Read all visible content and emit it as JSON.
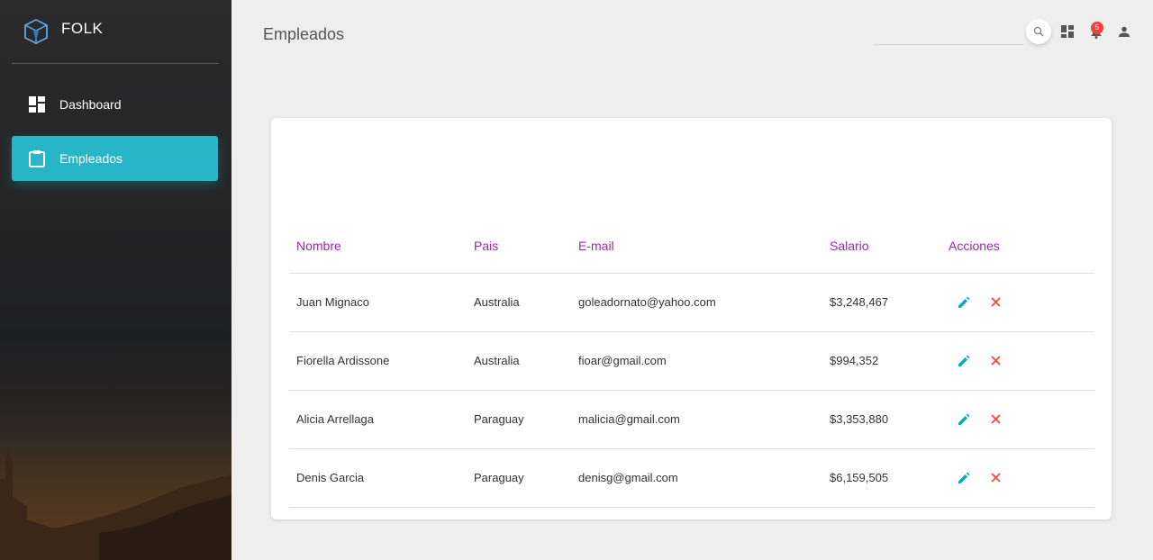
{
  "sidebar": {
    "brand": "FOLK",
    "items": [
      {
        "label": "Dashboard",
        "icon": "dashboard-icon"
      },
      {
        "label": "Empleados",
        "icon": "clipboard-icon",
        "active": true
      }
    ]
  },
  "header": {
    "title": "Empleados",
    "search_placeholder": "",
    "notification_count": "5"
  },
  "table": {
    "columns": [
      "Nombre",
      "Pais",
      "E-mail",
      "Salario",
      "Acciones"
    ],
    "rows": [
      {
        "nombre": "Juan Mignaco",
        "pais": "Australia",
        "email": "goleadornato@yahoo.com",
        "salario": "$3,248,467"
      },
      {
        "nombre": "Fiorella Ardissone",
        "pais": "Australia",
        "email": "fioar@gmail.com",
        "salario": "$994,352"
      },
      {
        "nombre": "Alicia Arrellaga",
        "pais": "Paraguay",
        "email": "malicia@gmail.com",
        "salario": "$3,353,880"
      },
      {
        "nombre": "Denis Garcia",
        "pais": "Paraguay",
        "email": "denisg@gmail.com",
        "salario": "$6,159,505"
      }
    ]
  },
  "colors": {
    "accent": "#26b6c8",
    "header_text": "#9c27b0",
    "edit_icon": "#00acc1",
    "delete_icon": "#f44336",
    "badge": "#f44336"
  }
}
